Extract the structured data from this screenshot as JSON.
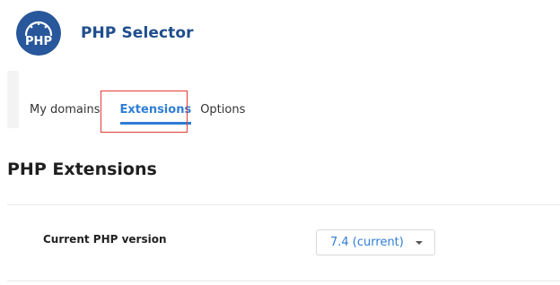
{
  "app": {
    "title": "PHP Selector",
    "logo_text": "PHP",
    "brand_color": "#28579b",
    "title_color": "#1f4e8c"
  },
  "tabs": [
    {
      "label": "My domains",
      "active": false
    },
    {
      "label": "Extensions",
      "active": true
    },
    {
      "label": "Options",
      "active": false
    }
  ],
  "section": {
    "title": "PHP Extensions"
  },
  "php_version": {
    "label": "Current PHP version",
    "selected": "7.4 (current)"
  },
  "colors": {
    "accent": "#2f7dd6",
    "highlight_box": "#e53935"
  }
}
